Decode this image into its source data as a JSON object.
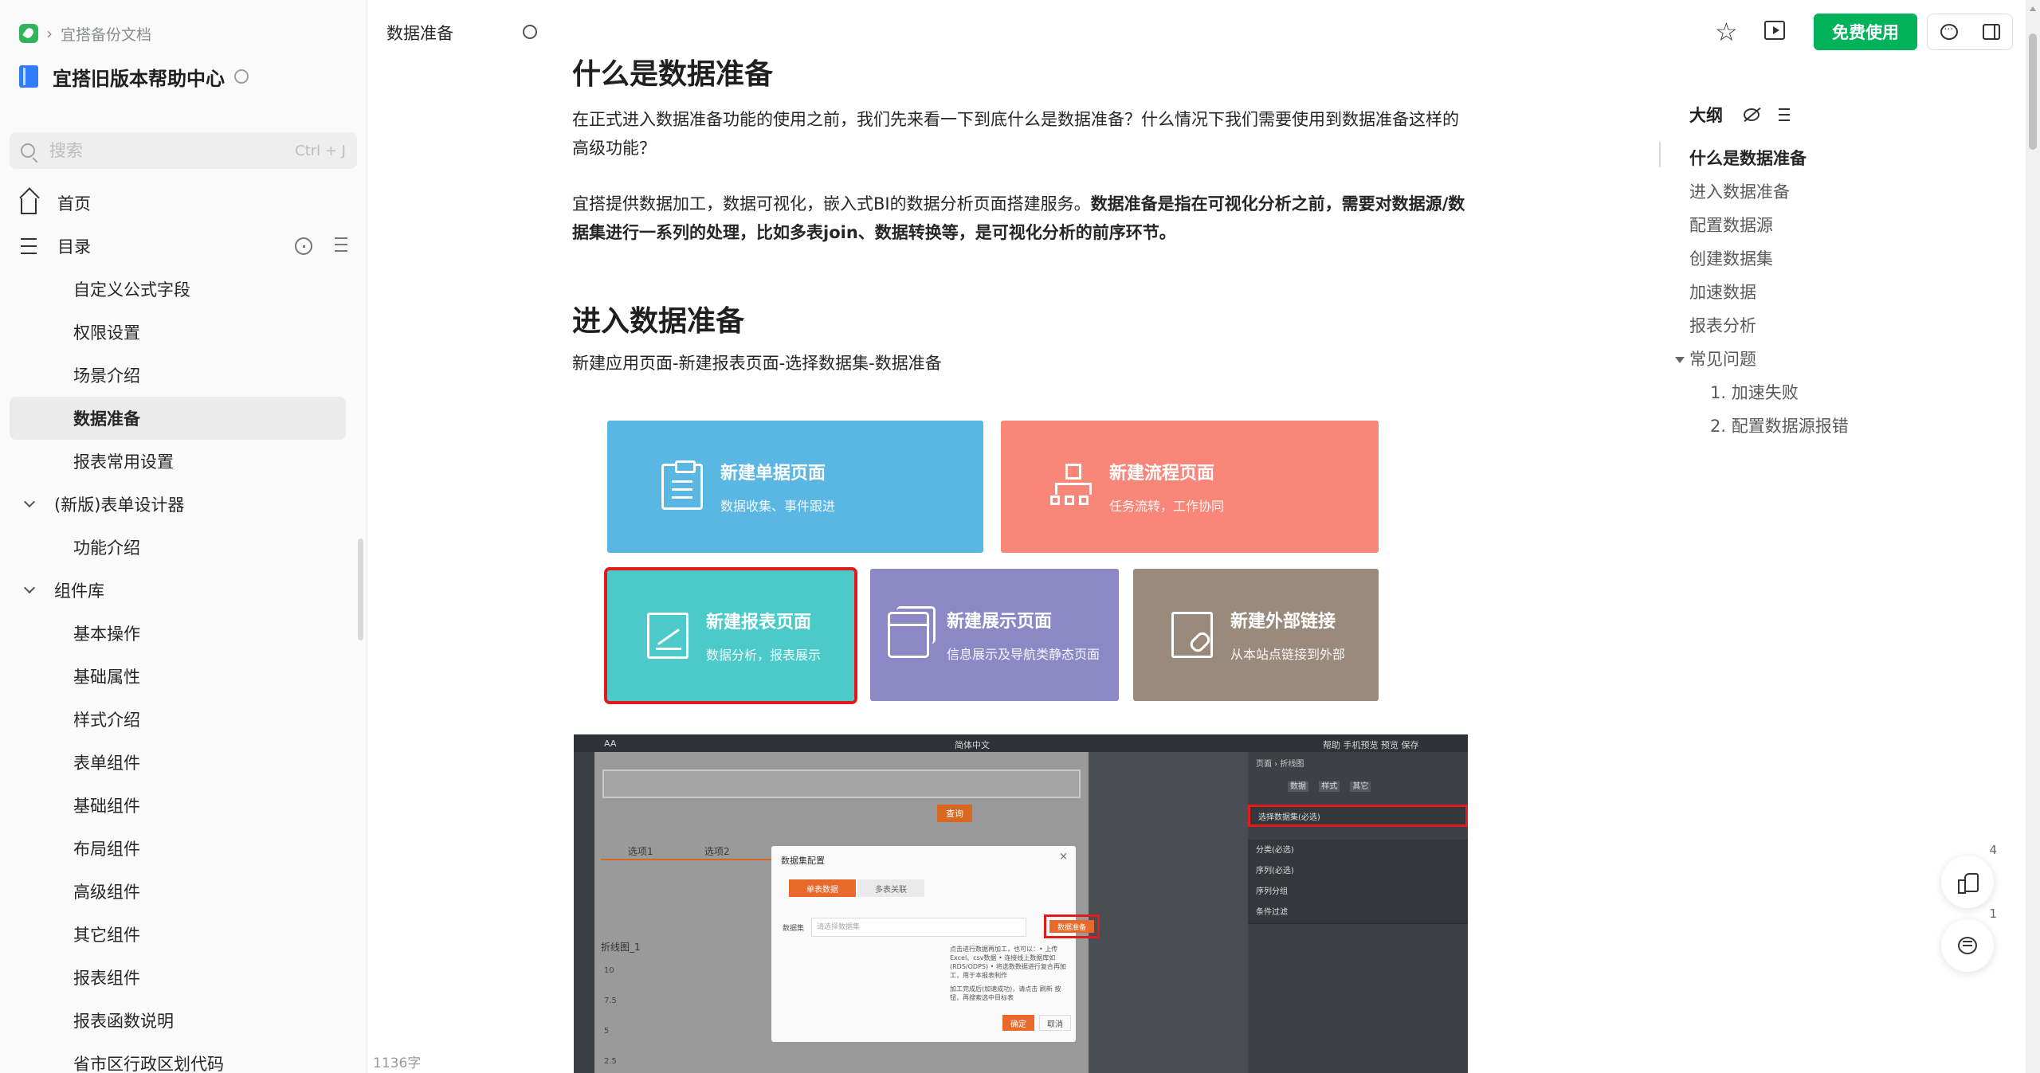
{
  "sidebar": {
    "breadcrumb": "宜搭备份文档",
    "kb_title": "宜搭旧版本帮助中心",
    "search": {
      "placeholder": "搜索",
      "shortcut": "Ctrl + J"
    },
    "home_label": "首页",
    "toc_label": "目录",
    "tree": [
      {
        "label": "自定义公式字段",
        "level": 2
      },
      {
        "label": "权限设置",
        "level": 2
      },
      {
        "label": "场景介绍",
        "level": 2
      },
      {
        "label": "数据准备",
        "level": 2,
        "active": true
      },
      {
        "label": "报表常用设置",
        "level": 2
      },
      {
        "label": "(新版)表单设计器",
        "level": 1
      },
      {
        "label": "功能介绍",
        "level": 2
      },
      {
        "label": "组件库",
        "level": 1
      },
      {
        "label": "基本操作",
        "level": 2
      },
      {
        "label": "基础属性",
        "level": 2
      },
      {
        "label": "样式介绍",
        "level": 2
      },
      {
        "label": "表单组件",
        "level": 2
      },
      {
        "label": "基础组件",
        "level": 2
      },
      {
        "label": "布局组件",
        "level": 2
      },
      {
        "label": "高级组件",
        "level": 2
      },
      {
        "label": "其它组件",
        "level": 2
      },
      {
        "label": "报表组件",
        "level": 2
      },
      {
        "label": "报表函数说明",
        "level": 2
      },
      {
        "label": "省市区行政区划代码",
        "level": 2
      }
    ],
    "word_count": "1136字"
  },
  "header": {
    "doc_title": "数据准备",
    "free_button": "免费使用"
  },
  "content": {
    "h1": "什么是数据准备",
    "p1": "在正式进入数据准备功能的使用之前，我们先来看一下到底什么是数据准备？什么情况下我们需要使用到数据准备这样的高级功能？",
    "p2_normal": "宜搭提供数据加工，数据可视化，嵌入式BI的数据分析页面搭建服务。",
    "p2_bold": "数据准备是指在可视化分析之前，需要对数据源/数据集进行一系列的处理，比如多表join、数据转换等，是可视化分析的前序环节。",
    "h2": "进入数据准备",
    "path": "新建应用页面-新建报表页面-选择数据集-数据准备",
    "cards": [
      {
        "title": "新建单据页面",
        "subtitle": "数据收集、事件跟进",
        "icon": "clipboard-icon",
        "color": "#5ab6e2"
      },
      {
        "title": "新建流程页面",
        "subtitle": "任务流转，工作协同",
        "icon": "flowchart-icon",
        "color": "#f8877a"
      },
      {
        "title": "新建报表页面",
        "subtitle": "数据分析，报表展示",
        "icon": "chart-icon",
        "color": "#4ccac9"
      },
      {
        "title": "新建展示页面",
        "subtitle": "信息展示及导航类静态页面",
        "icon": "window-icon",
        "color": "#8b88c5"
      },
      {
        "title": "新建外部链接",
        "subtitle": "从本站点链接到外部",
        "icon": "link-icon",
        "color": "#9a8a7c"
      }
    ],
    "screenshot": {
      "aa": "AA",
      "lang": "简体中文",
      "top_right": "帮助   手机预览   预览   保存",
      "query_button": "查询",
      "tab1": "选项1",
      "tab2": "选项2",
      "chart_label": "折线图_1",
      "ticks": [
        "10",
        "7.5",
        "5",
        "2.5"
      ],
      "panel_path": "页面 › 折线图",
      "panel_tabs": [
        "数据",
        "样式",
        "其它"
      ],
      "panel_rows": [
        "选择数据集(必选)",
        "分类(必选)",
        "序列(必选)",
        "序列分组",
        "条件过滤"
      ],
      "dialog": {
        "title": "数据集配置",
        "tab_single": "单表数据",
        "tab_multi": "多表关联",
        "label": "数据集",
        "select_placeholder": "请选择数据集",
        "prep_button": "数据准备",
        "notes": "点击进行数据再加工，也可以：• 上传Excel、csv数据 • 连接线上数据库如(RDS/ODPS) • 将选数数据进行复合再加工，用于本报表制作",
        "notes2": "加工完成后(加速成功)，请点击 刷新 按钮，再搜索选中目标表",
        "ok": "确定",
        "cancel": "取消"
      }
    }
  },
  "outline": {
    "title": "大纲",
    "items": [
      {
        "label": "什么是数据准备",
        "active": true
      },
      {
        "label": "进入数据准备"
      },
      {
        "label": "配置数据源"
      },
      {
        "label": "创建数据集"
      },
      {
        "label": "加速数据"
      },
      {
        "label": "报表分析"
      },
      {
        "label": "常见问题",
        "collapsible": true
      },
      {
        "label": "1. 加速失败",
        "sub": true
      },
      {
        "label": "2. 配置数据源报错",
        "sub": true
      }
    ]
  },
  "floating": {
    "like_count": "4",
    "comment_count": "1"
  }
}
